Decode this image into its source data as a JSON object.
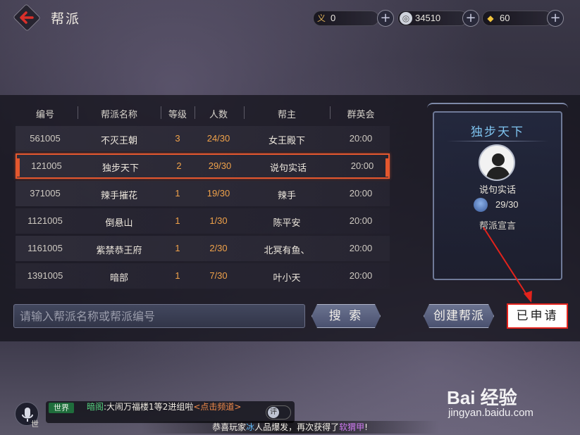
{
  "header": {
    "title": "帮派",
    "resources": [
      {
        "icon": "righteousness-icon",
        "glyph": "义",
        "value": "0"
      },
      {
        "icon": "silver-coin-icon",
        "glyph": "◎",
        "value": "34510"
      },
      {
        "icon": "gold-ingot-icon",
        "glyph": "◆",
        "value": "60"
      }
    ],
    "plus": "+"
  },
  "table": {
    "columns": [
      "编号",
      "帮派名称",
      "等级",
      "人数",
      "帮主",
      "群英会"
    ],
    "rows": [
      {
        "id": "561005",
        "name": "不灭王朝",
        "level": "3",
        "members": "24/30",
        "leader": "女王殿下",
        "time": "20:00"
      },
      {
        "id": "121005",
        "name": "独步天下",
        "level": "2",
        "members": "29/30",
        "leader": "说句实话",
        "time": "20:00"
      },
      {
        "id": "371005",
        "name": "辣手摧花",
        "level": "1",
        "members": "19/30",
        "leader": "辣手",
        "time": "20:00"
      },
      {
        "id": "1121005",
        "name": "倒悬山",
        "level": "1",
        "members": "1/30",
        "leader": "陈平安",
        "time": "20:00"
      },
      {
        "id": "1161005",
        "name": "紫禁恭王府",
        "level": "1",
        "members": "2/30",
        "leader": "北冥有鱼、",
        "time": "20:00"
      },
      {
        "id": "1391005",
        "name": "暗部",
        "level": "1",
        "members": "7/30",
        "leader": "叶小天",
        "time": "20:00"
      }
    ],
    "selected_index": 1
  },
  "detail": {
    "name": "独步天下",
    "leader": "说句实话",
    "members": "29/30",
    "declaration_label": "帮派宣言"
  },
  "search": {
    "placeholder": "请输入帮派名称或帮派编号",
    "button": "搜 索"
  },
  "actions": {
    "create": "创建帮派",
    "applied": "已申请"
  },
  "chat": {
    "mic_label": "世",
    "channel": "世界",
    "sender": "暗阁",
    "message": ":大闹万福楼1等2进组啦",
    "link": "<点击频道>",
    "eval": "评"
  },
  "ticker": {
    "prefix": "恭喜玩家",
    "player": "冰",
    "middle": "人品爆发，再次获得了",
    "item": "软猬甲",
    "suffix": "!"
  },
  "watermark": {
    "main": "Bai 经验",
    "sub": "jingyan.baidu.com"
  },
  "colors": {
    "selected_border": "#e4572e",
    "level_text": "#f0a24a",
    "guild_name": "#7fc4f0",
    "annotation_red": "#e3231c"
  }
}
